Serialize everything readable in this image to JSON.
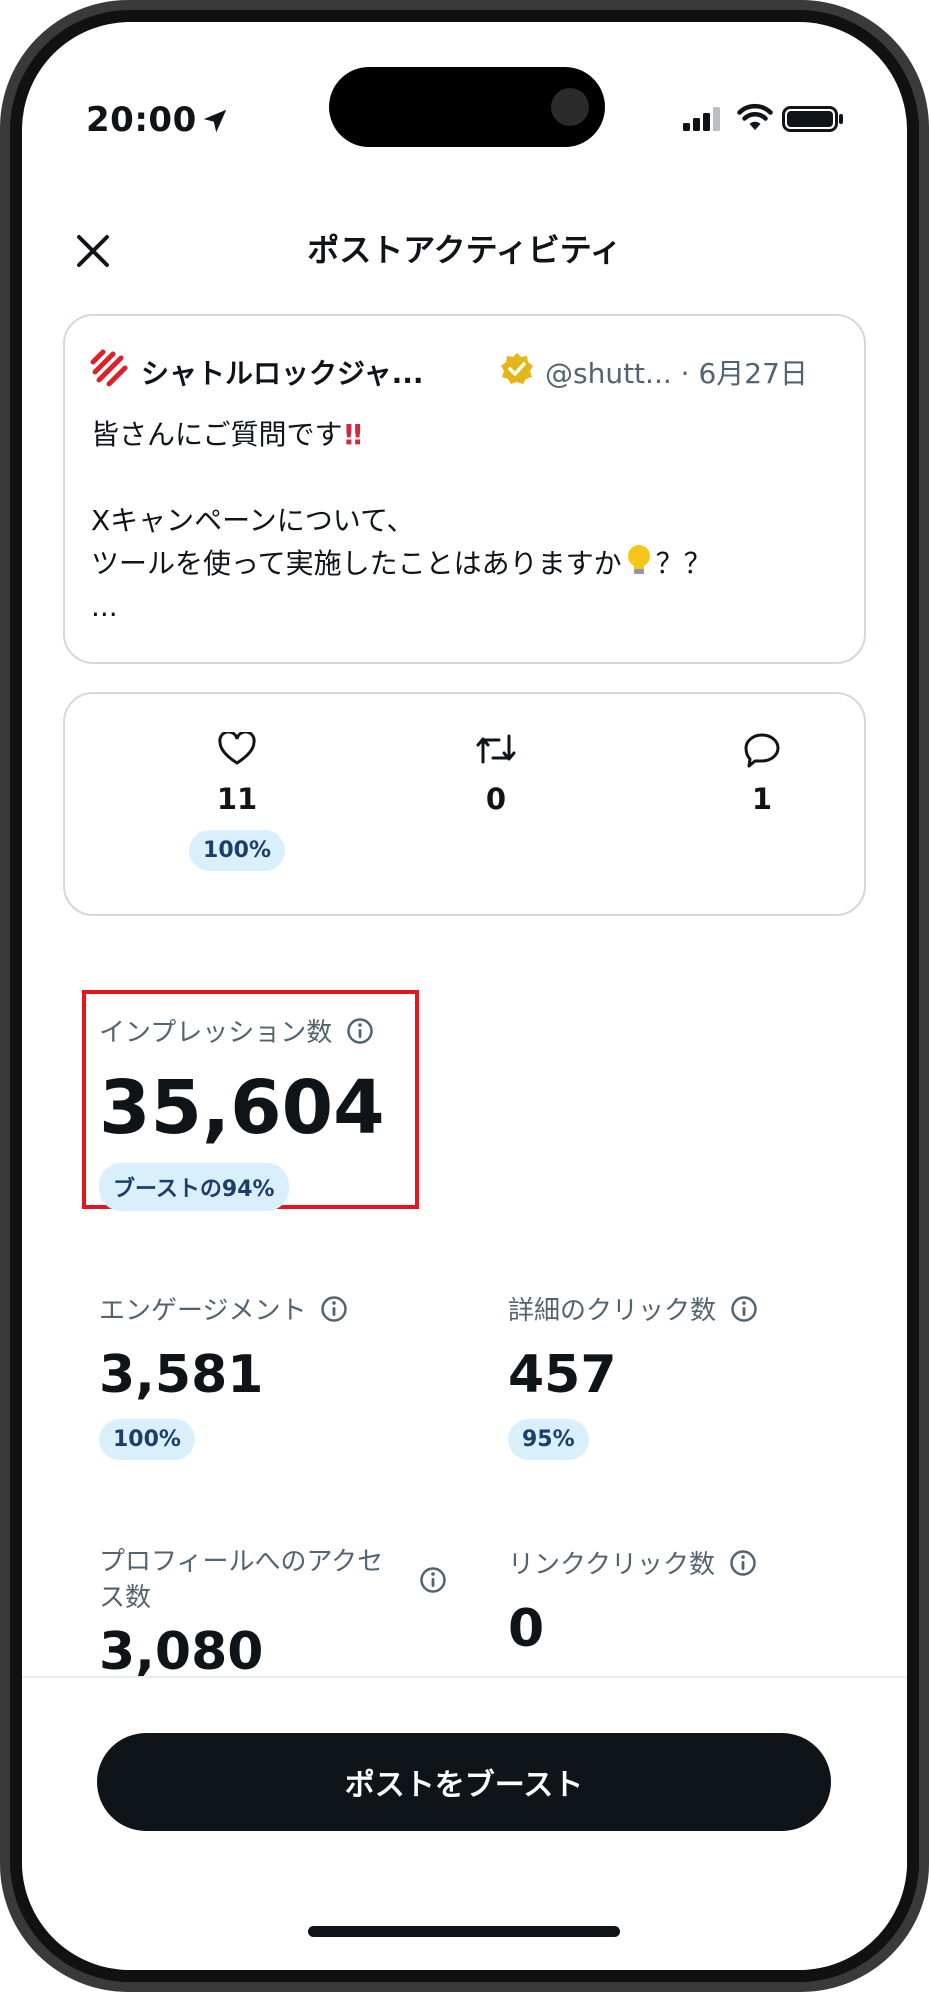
{
  "status_bar": {
    "time": "20:00"
  },
  "header": {
    "title": "ポストアクティビティ"
  },
  "post": {
    "author_name": "シャトルロックジャ...",
    "handle_date": "@shutt... · 6月27日",
    "line1": "皆さんにご質問です",
    "line1_emoji": "!!",
    "line2": "Xキャンペーンについて、",
    "line3_a": "ツールを使って実施したことはありますか",
    "line3_b": "？？",
    "line4": "..."
  },
  "engagement": {
    "likes": {
      "count": "11",
      "badge": "100%"
    },
    "reposts": {
      "count": "0"
    },
    "replies": {
      "count": "1"
    }
  },
  "metrics": {
    "impressions": {
      "label": "インプレッション数",
      "value": "35,604",
      "badge": "ブーストの94%"
    },
    "engagements": {
      "label": "エンゲージメント",
      "value": "3,581",
      "badge": "100%"
    },
    "detail_clicks": {
      "label": "詳細のクリック数",
      "value": "457",
      "badge": "95%"
    },
    "profile_visits": {
      "label": "プロフィールへのアクセス数",
      "value": "3,080"
    },
    "link_clicks": {
      "label": "リンククリック数",
      "value": "0"
    }
  },
  "footer": {
    "boost_button": "ポストをブースト"
  },
  "colors": {
    "text_primary": "#0f1419",
    "text_secondary": "#536471",
    "badge_bg": "#d9f0fc",
    "highlight_border": "#e3151f",
    "border": "#cfd9de"
  },
  "icons": [
    "location-arrow-icon",
    "signal-icon",
    "wifi-icon",
    "battery-icon",
    "close-icon",
    "brand-logo",
    "verified-badge-icon",
    "lightbulb-icon",
    "heart-icon",
    "repost-icon",
    "reply-icon",
    "info-icon"
  ]
}
